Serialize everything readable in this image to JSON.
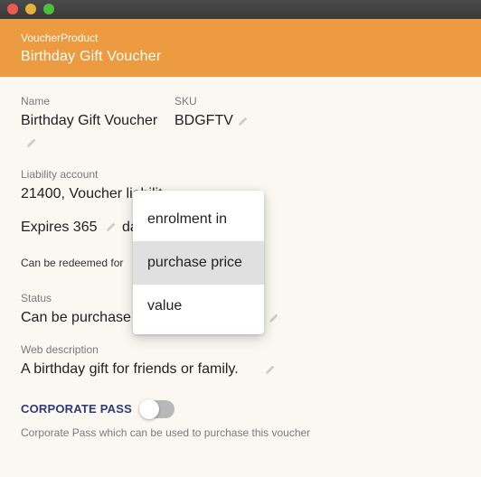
{
  "header": {
    "entity": "VoucherProduct",
    "title": "Birthday Gift Voucher"
  },
  "fields": {
    "name": {
      "label": "Name",
      "value": "Birthday Gift Voucher"
    },
    "sku": {
      "label": "SKU",
      "value": "BDGFTV"
    },
    "liability": {
      "label": "Liability account",
      "value": "21400, Voucher liabilit"
    },
    "expires": {
      "prefix": "Expires 365",
      "suffix": "da"
    },
    "redeem": {
      "text": "Can be redeemed for"
    },
    "status": {
      "label": "Status",
      "value": "Can be purchase"
    },
    "web": {
      "label": "Web description",
      "value": "A birthday gift for friends or family."
    }
  },
  "corporate_pass": {
    "label": "CORPORATE PASS",
    "enabled": false,
    "hint": "Corporate Pass which can be used to purchase this voucher"
  },
  "dropdown": {
    "options": [
      "enrolment in",
      "purchase price",
      "value"
    ],
    "selected": "purchase price"
  },
  "icons": {
    "edit": "pencil-icon"
  }
}
